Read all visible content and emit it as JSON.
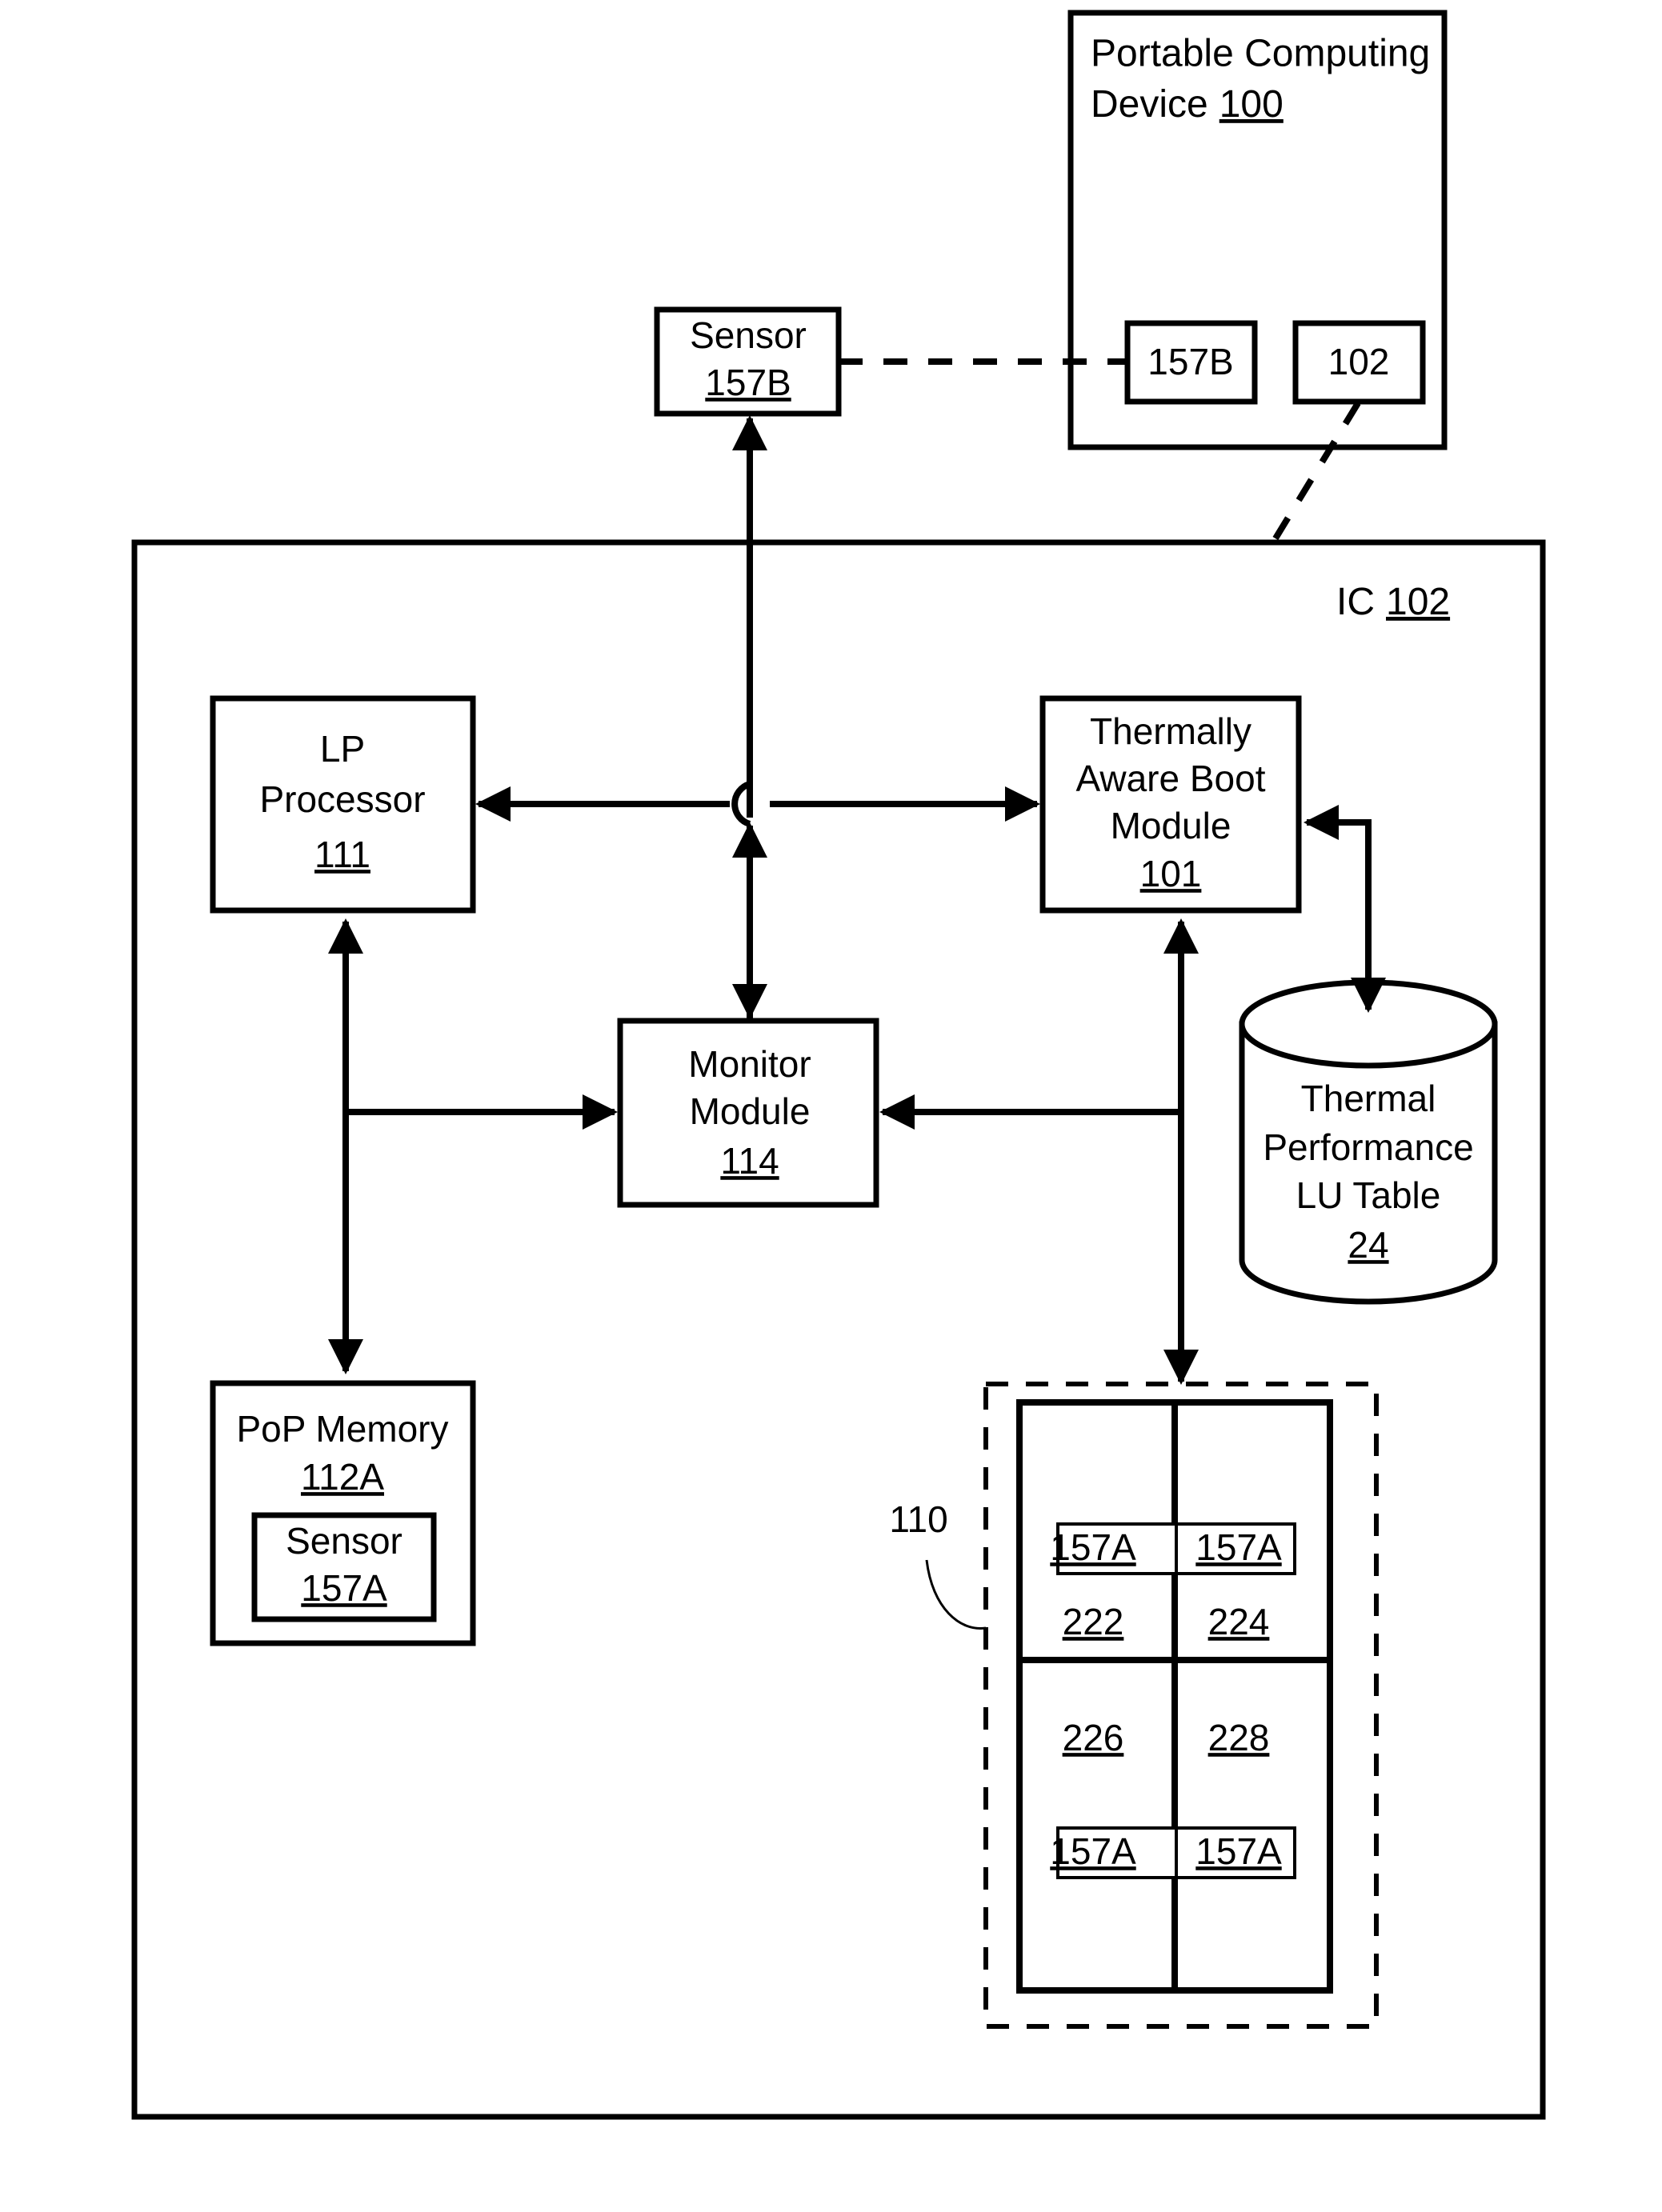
{
  "diagram": {
    "figure_type": "patent-block-diagram",
    "colors": {
      "stroke": "#000000",
      "fill": "#ffffff"
    },
    "blocks": {
      "pcd": {
        "title_line1": "Portable Computing",
        "title_line2": "Device",
        "ref": "100"
      },
      "pcd_sensor": {
        "ref": "157B"
      },
      "pcd_ic": {
        "ref": "102"
      },
      "sensor_external": {
        "label": "Sensor",
        "ref": "157B"
      },
      "ic": {
        "label": "IC",
        "ref": "102"
      },
      "lp_processor": {
        "line1": "LP",
        "line2": "Processor",
        "ref": "111"
      },
      "boot_module": {
        "line1": "Thermally",
        "line2": "Aware Boot",
        "line3": "Module",
        "ref": "101"
      },
      "monitor_module": {
        "line1": "Monitor",
        "line2": "Module",
        "ref": "114"
      },
      "lu_table": {
        "line1": "Thermal",
        "line2": "Performance",
        "line3": "LU Table",
        "ref": "24"
      },
      "pop_memory": {
        "label": "PoP Memory",
        "ref": "112A",
        "sensor_label": "Sensor",
        "sensor_ref": "157A"
      },
      "core_group": {
        "ref": "110"
      },
      "cores": [
        {
          "sensor_ref": "157A",
          "ref": "222",
          "sensor_position": "top"
        },
        {
          "sensor_ref": "157A",
          "ref": "224",
          "sensor_position": "top"
        },
        {
          "sensor_ref": "157A",
          "ref": "226",
          "sensor_position": "bottom"
        },
        {
          "sensor_ref": "157A",
          "ref": "228",
          "sensor_position": "bottom"
        }
      ]
    }
  }
}
